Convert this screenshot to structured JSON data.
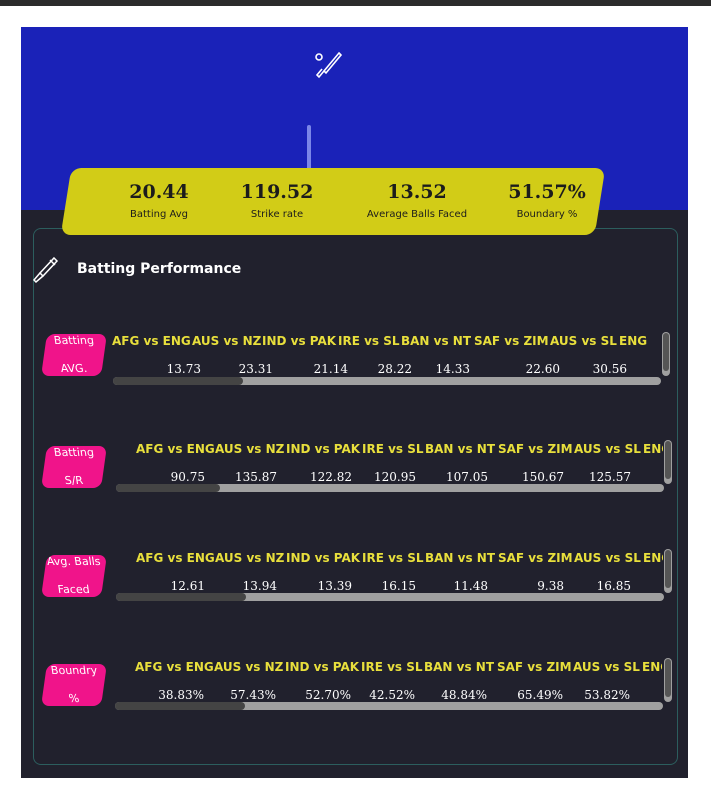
{
  "colors": {
    "hero": "#1a22b8",
    "stats_bg": "#d2cc17",
    "tag": "#f0148a",
    "match_label": "#e8df3c",
    "panel_bg": "#21212d"
  },
  "hero": {
    "icon": "cricket-bat-icon"
  },
  "stats": [
    {
      "value": "20.44",
      "label": "Batting Avg"
    },
    {
      "value": "119.52",
      "label": "Strike rate"
    },
    {
      "value": "13.52",
      "label": "Average Balls Faced"
    },
    {
      "value": "51.57%",
      "label": "Boundary %"
    }
  ],
  "section": {
    "icon": "cricket-bat-icon",
    "title": "Batting Performance"
  },
  "matches": [
    "AFG vs ENG",
    "AUS vs NZ",
    "IND vs PAK",
    "IRE vs SL",
    "BAN vs NT",
    "SAF vs ZIM",
    "AUS vs SL",
    "ENG"
  ],
  "rows": [
    {
      "tag_line1": "Batting",
      "tag_line2": "AVG.",
      "values": [
        "13.73",
        "23.31",
        "21.14",
        "28.22",
        "14.33",
        "22.60",
        "30.56"
      ]
    },
    {
      "tag_line1": "Batting",
      "tag_line2": "S/R",
      "values": [
        "90.75",
        "135.87",
        "122.82",
        "120.95",
        "107.05",
        "150.67",
        "125.57"
      ]
    },
    {
      "tag_line1": "Avg. Balls",
      "tag_line2": "Faced",
      "values": [
        "12.61",
        "13.94",
        "13.39",
        "16.15",
        "11.48",
        "9.38",
        "16.85"
      ]
    },
    {
      "tag_line1": "Boundry",
      "tag_line2": "%",
      "values": [
        "38.83%",
        "57.43%",
        "52.70%",
        "42.52%",
        "48.84%",
        "65.49%",
        "53.82%"
      ]
    }
  ]
}
